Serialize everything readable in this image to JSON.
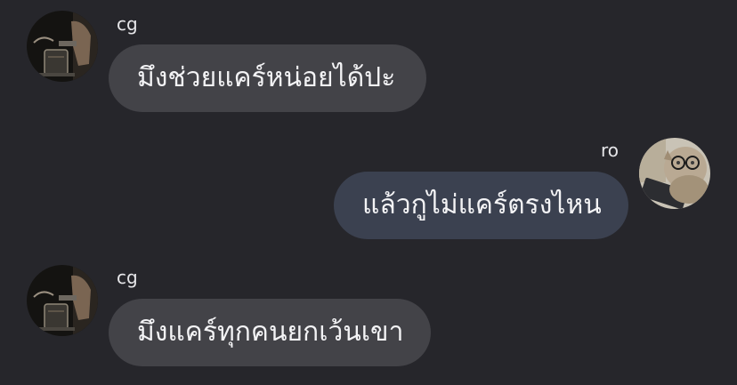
{
  "messages": [
    {
      "sender": "cg",
      "text": "มึงช่วยแคร์หน่อยได้ปะ",
      "avatar_icon": "coffee-pour-avatar-icon",
      "direction": "incoming"
    },
    {
      "sender": "ro",
      "text": "แล้วกูไม่แคร์ตรงไหน",
      "avatar_icon": "cat-with-glasses-avatar-icon",
      "direction": "outgoing"
    },
    {
      "sender": "cg",
      "text": "มึงแคร์ทุกคนยกเว้นเขา",
      "avatar_icon": "coffee-pour-avatar-icon",
      "direction": "incoming"
    }
  ],
  "colors": {
    "background": "#26262b",
    "incoming_bubble": "#434348",
    "outgoing_bubble": "#3b4150",
    "text": "#f3f3f5"
  }
}
